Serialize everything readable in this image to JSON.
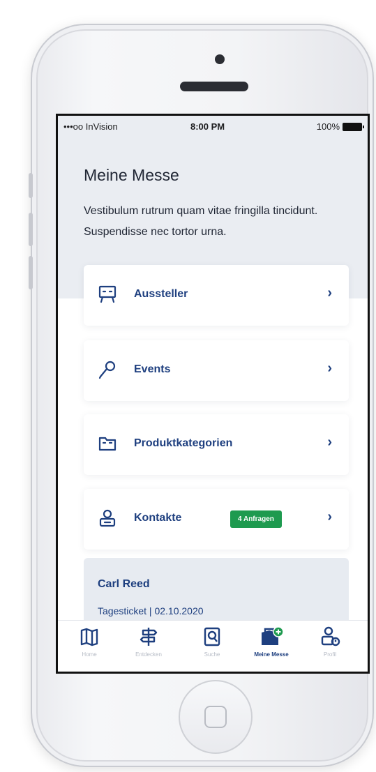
{
  "status_bar": {
    "carrier": "•••oo InVision",
    "time": "8:00 PM",
    "battery": "100%"
  },
  "page": {
    "title": "Meine Messe",
    "description": "Vestibulum rutrum quam vitae fringilla tincidunt. Suspendisse nec tortor urna."
  },
  "menu": {
    "items": [
      {
        "label": "Aussteller",
        "icon": "presentation-board-icon"
      },
      {
        "label": "Events",
        "icon": "microphone-icon"
      },
      {
        "label": "Produktkategorien",
        "icon": "folder-icon"
      },
      {
        "label": "Kontakte",
        "icon": "contact-person-icon",
        "badge": "4 Anfragen"
      }
    ],
    "chevron": "›"
  },
  "ticket": {
    "name": "Carl Reed",
    "info": "Tagesticket | 02.10.2020"
  },
  "tab_bar": {
    "tabs": [
      {
        "label": "Home",
        "icon": "map-icon"
      },
      {
        "label": "Entdecken",
        "icon": "signpost-icon"
      },
      {
        "label": "Suche",
        "icon": "search-book-icon"
      },
      {
        "label": "Meine Messe",
        "icon": "bag-plus-icon",
        "active": true
      },
      {
        "label": "Profil",
        "icon": "profile-icon"
      }
    ]
  },
  "colors": {
    "brand": "#1e3f7f",
    "badge": "#1e9a4f",
    "header_bg": "#eaedf2"
  }
}
